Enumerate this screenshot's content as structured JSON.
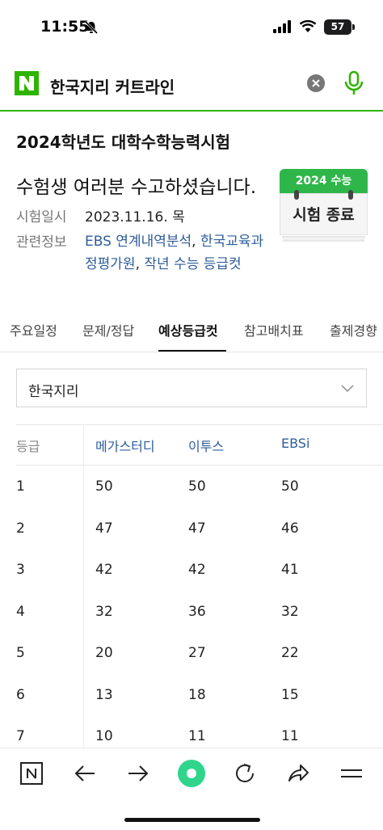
{
  "status": {
    "time": "11:55",
    "battery": "57"
  },
  "search": {
    "query": "한국지리 커트라인"
  },
  "exam": {
    "title": "2024학년도 대학수학능력시험",
    "message": "수험생 여러분 수고하셨습니다.",
    "date_label": "시험일시",
    "date_value": "2023.11.16. 목",
    "info_label": "관련정보",
    "links": [
      "EBS 연계내역분석",
      "한국교육과정평가원",
      "작년 수능 등급컷"
    ],
    "badge_year": "2024 수능",
    "badge_status": "시험 종료"
  },
  "tabs": [
    "주요일정",
    "문제/정답",
    "예상등급컷",
    "참고배치표",
    "출제경향"
  ],
  "active_tab": "예상등급컷",
  "subject_select": {
    "value": "한국지리"
  },
  "table": {
    "headers": [
      "등급",
      "메가스터디",
      "이투스",
      "EBSi"
    ],
    "rows": [
      [
        "1",
        "50",
        "50",
        "50"
      ],
      [
        "2",
        "47",
        "47",
        "46"
      ],
      [
        "3",
        "42",
        "42",
        "41"
      ],
      [
        "4",
        "32",
        "36",
        "32"
      ],
      [
        "5",
        "20",
        "27",
        "22"
      ],
      [
        "6",
        "13",
        "18",
        "15"
      ],
      [
        "7",
        "10",
        "11",
        "11"
      ]
    ]
  },
  "colors": {
    "brand_green": "#2db400",
    "link_blue": "#2d5d9c",
    "badge_green": "#2fb64a"
  },
  "bottom_nav": [
    "naver-n-icon",
    "back-arrow-icon",
    "forward-arrow-icon",
    "green-dot-icon",
    "reload-icon",
    "share-icon",
    "menu-icon"
  ]
}
